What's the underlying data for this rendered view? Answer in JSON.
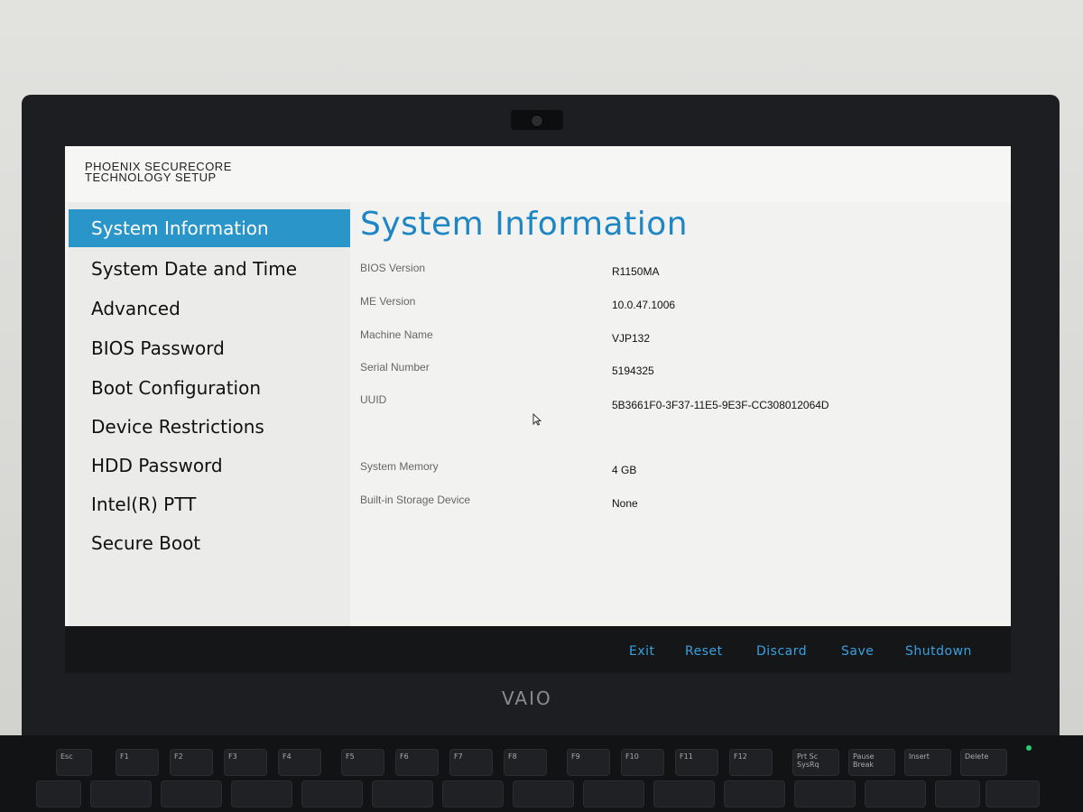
{
  "app": {
    "brand_line1": "PHOENIX SECURECORE",
    "brand_line2": "TECHNOLOGY SETUP"
  },
  "sidebar": {
    "items": [
      {
        "label": "System Information",
        "active": true
      },
      {
        "label": "System Date and Time",
        "active": false
      },
      {
        "label": "Advanced",
        "active": false
      },
      {
        "label": "BIOS Password",
        "active": false
      },
      {
        "label": "Boot Configuration",
        "active": false
      },
      {
        "label": "Device Restrictions",
        "active": false
      },
      {
        "label": "HDD Password",
        "active": false
      },
      {
        "label": "Intel(R) PTT",
        "active": false
      },
      {
        "label": "Secure Boot",
        "active": false
      }
    ]
  },
  "main": {
    "title": "System Information",
    "rows": [
      {
        "label": "BIOS Version",
        "value": "R1150MA"
      },
      {
        "label": "ME Version",
        "value": "10.0.47.1006"
      },
      {
        "label": "Machine Name",
        "value": "VJP132"
      },
      {
        "label": "Serial Number",
        "value": "5194325"
      },
      {
        "label": "UUID",
        "value": "5B3661F0-3F37-11E5-9E3F-CC308012064D"
      },
      {
        "label": "System Memory",
        "value": "4 GB"
      },
      {
        "label": "Built-in Storage Device",
        "value": "None"
      }
    ]
  },
  "footer": {
    "buttons": [
      "Exit",
      "Reset",
      "Discard",
      "Save",
      "Shutdown"
    ]
  },
  "device": {
    "logo": "VAIO"
  },
  "colors": {
    "accent": "#2a95c9",
    "title": "#1e86c5",
    "footer_link": "#3aa0e0"
  },
  "keyboard": {
    "keys": [
      "Esc",
      "F1",
      "F2",
      "F3",
      "F4",
      "F5",
      "F6",
      "F7",
      "F8",
      "F9",
      "F10",
      "F11",
      "F12",
      "Prt Sc SysRq",
      "Pause Break",
      "Insert",
      "Delete"
    ]
  }
}
